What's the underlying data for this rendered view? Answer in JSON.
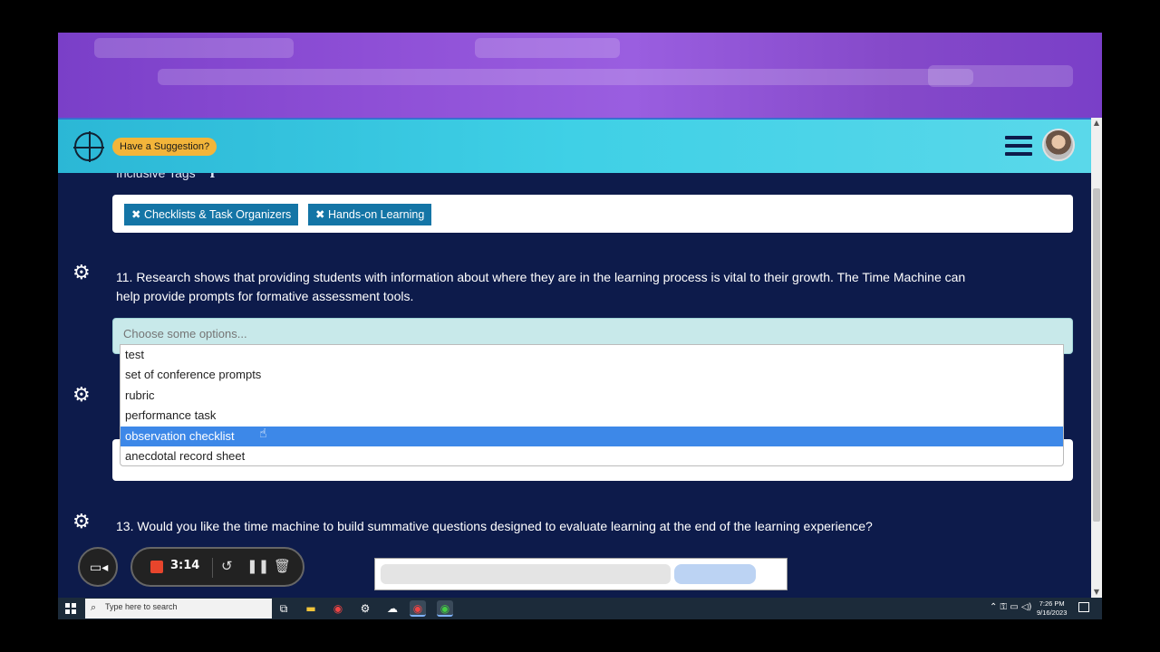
{
  "app": {
    "suggestion_button": "Have a Suggestion?"
  },
  "tags_section": {
    "label": "Inclusive Tags",
    "tags": [
      "Checklists & Task Organizers",
      "Hands-on Learning"
    ]
  },
  "questions": {
    "q11": {
      "line1": "11. Research shows that providing students with information about where they are in the learning process is vital  to their growth. The Time Machine can",
      "line2": "help provide prompts for formative assessment tools."
    },
    "q13": {
      "text": "13. Would you like the time machine to build summative questions designed to evaluate learning at the end of the learning experience?"
    }
  },
  "select": {
    "placeholder": "Choose some options...",
    "options": [
      "test",
      "set of conference prompts",
      "rubric",
      "performance task",
      "observation checklist",
      "anecdotal record sheet"
    ],
    "highlighted": "observation checklist"
  },
  "recorder": {
    "time": "3:14"
  },
  "taskbar": {
    "search_placeholder": "Type here to search",
    "time": "7:26 PM",
    "date": "9/16/2023"
  },
  "colors": {
    "page_bg": "#0d1b4b",
    "header_gradient": "#3fd0e6",
    "tag_bg": "#1475a6",
    "highlight": "#3d88e8",
    "suggest_btn": "#f3b53a"
  }
}
